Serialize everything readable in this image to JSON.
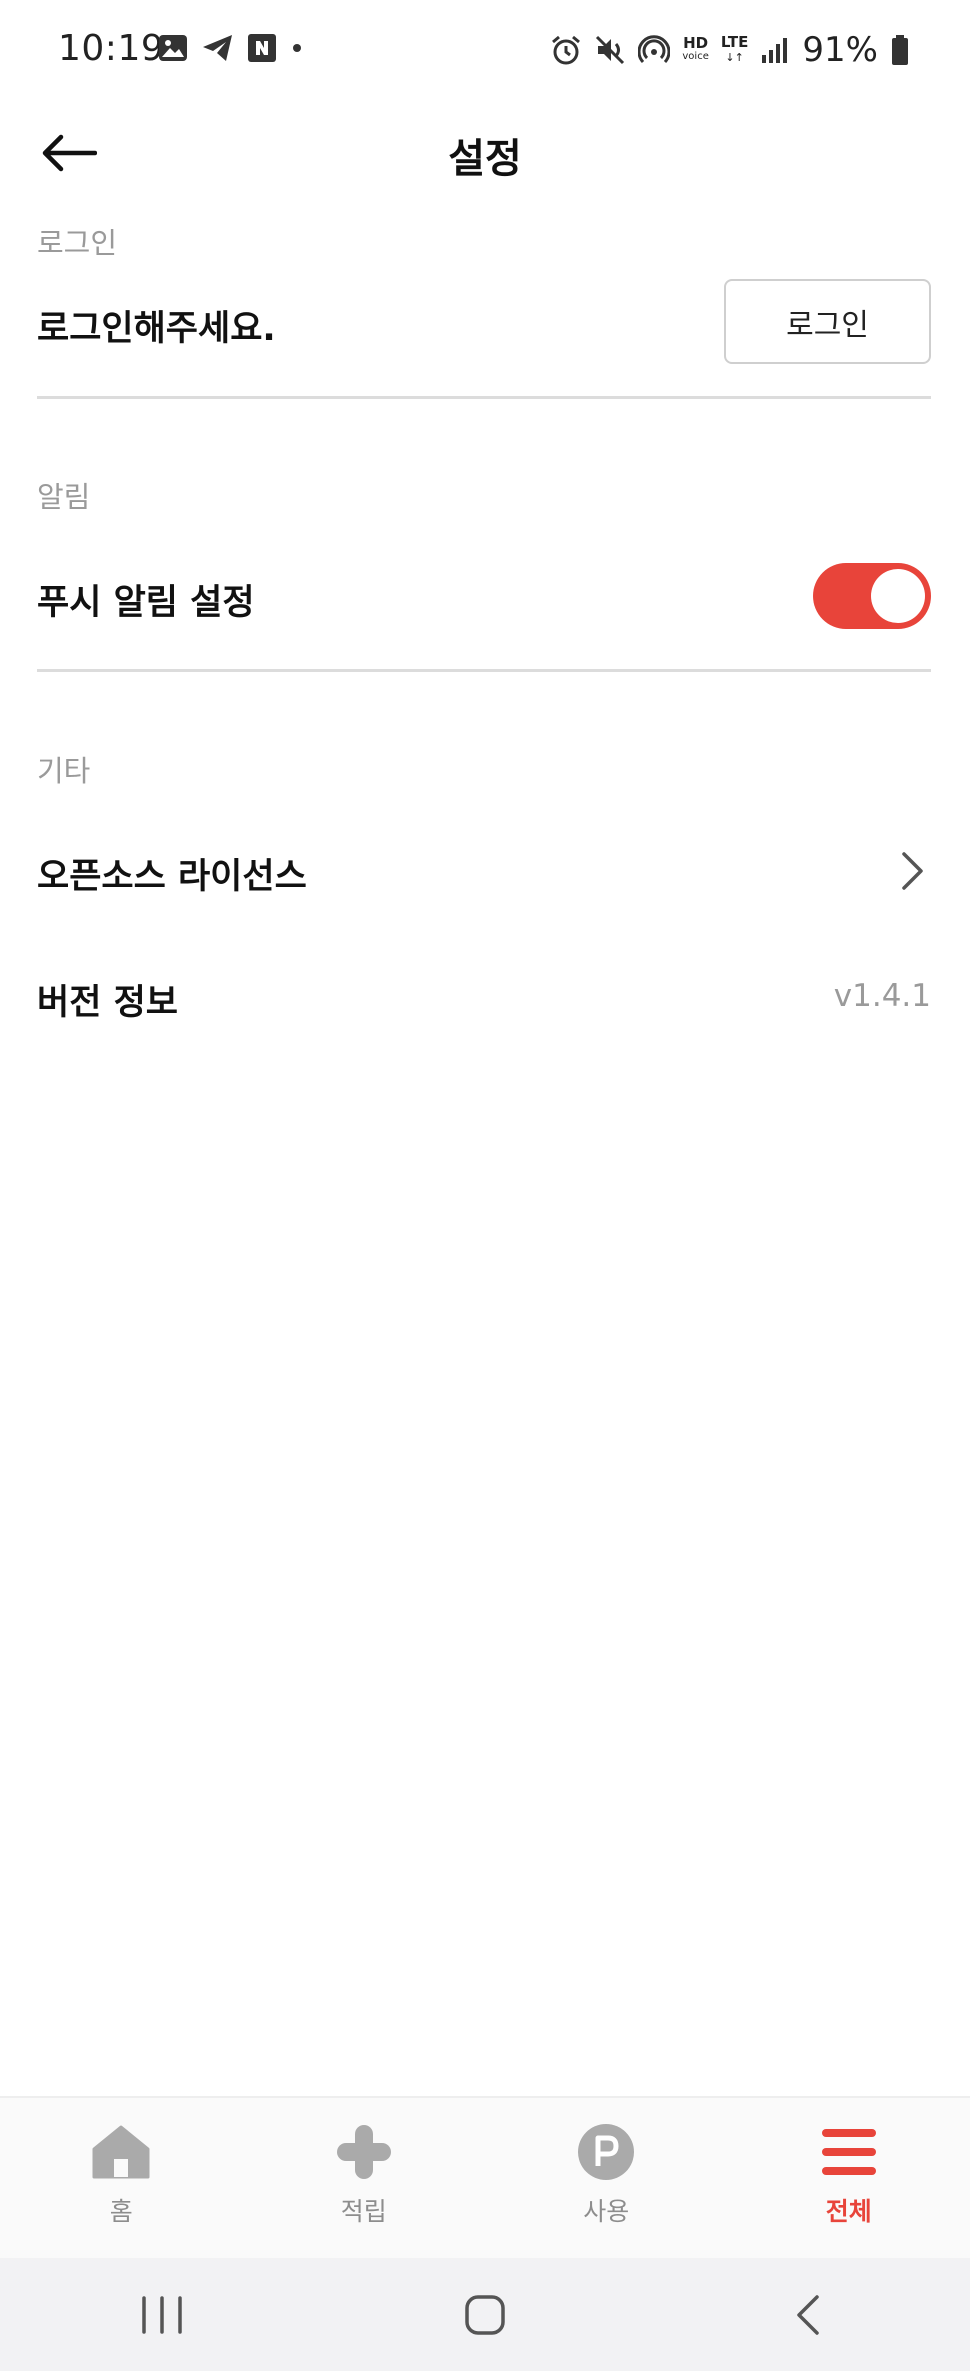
{
  "status_bar": {
    "time": "10:19",
    "battery": "91%",
    "hd_label": "HD",
    "hd_sub": "voice",
    "lte_label": "LTE",
    "left_icons": [
      "gallery-icon",
      "telegram-icon",
      "naver-icon",
      "dot-icon"
    ],
    "right_icons": [
      "alarm-icon",
      "mute-icon",
      "hotspot-icon",
      "signal-icon",
      "battery-icon"
    ]
  },
  "header": {
    "title": "설정"
  },
  "sections": {
    "login": {
      "label": "로그인",
      "message": "로그인해주세요.",
      "button_label": "로그인"
    },
    "notification": {
      "label": "알림",
      "push_label": "푸시 알림 설정",
      "push_enabled": true
    },
    "etc": {
      "label": "기타",
      "license_label": "오픈소스 라이선스",
      "version_label": "버전 정보",
      "version_value": "v1.4.1"
    }
  },
  "bottom_nav": {
    "items": [
      {
        "label": "홈",
        "icon": "home-icon",
        "active": false
      },
      {
        "label": "적립",
        "icon": "plus-icon",
        "active": false
      },
      {
        "label": "사용",
        "icon": "point-icon",
        "active": false
      },
      {
        "label": "전체",
        "icon": "menu-icon",
        "active": true
      }
    ]
  },
  "colors": {
    "accent": "#e8443a",
    "muted": "#9a9a9a",
    "divider": "#dcdcdc",
    "nav_inactive": "#aaaaaa"
  }
}
